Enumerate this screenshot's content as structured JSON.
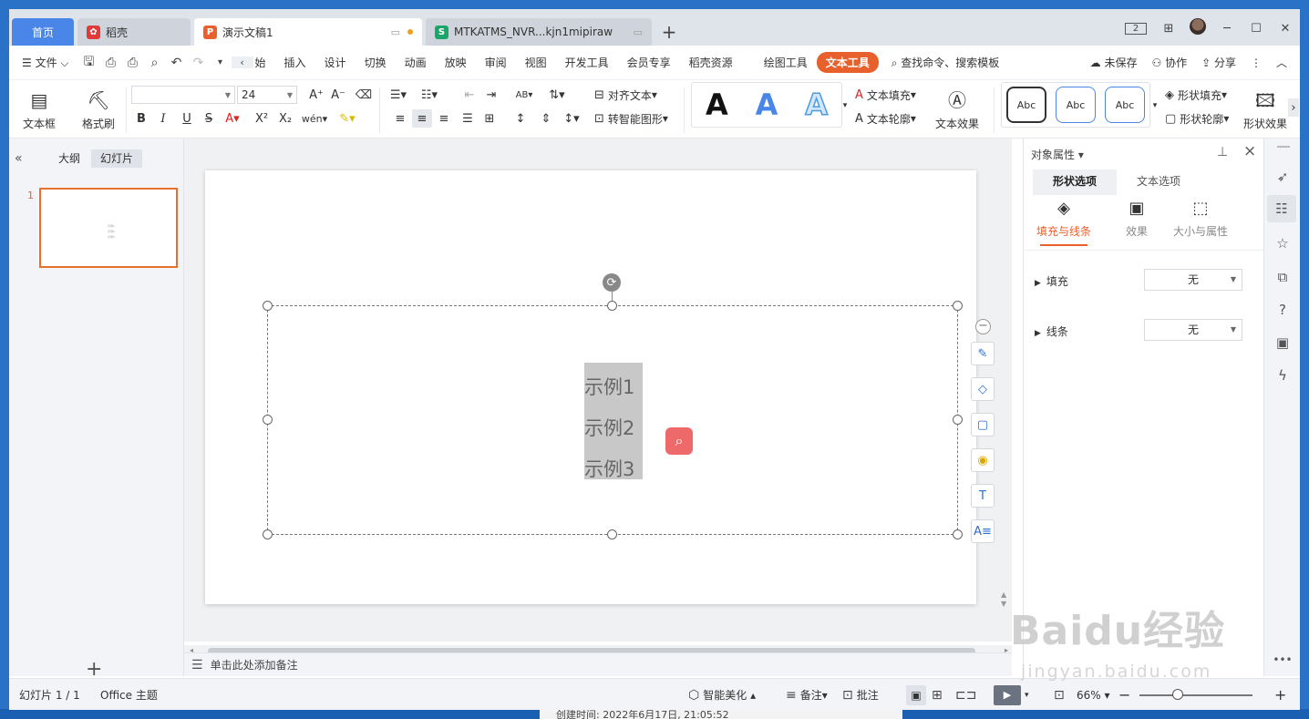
{
  "desktop": {
    "underlying_window_text": "创建时间:        2022年6月17日, 21:05:52"
  },
  "tabs": {
    "home": "首页",
    "docer": "稻壳",
    "presentation": "演示文稿1",
    "sheet": "MTKATMS_NVR...kjn1mipiraw",
    "add": "+"
  },
  "window_controls": {
    "layout_badge": "2",
    "apps": "⊞",
    "minimize": "─",
    "maximize": "☐",
    "close": "✕"
  },
  "menu": {
    "file": "文件",
    "items": [
      "始",
      "插入",
      "设计",
      "切换",
      "动画",
      "放映",
      "审阅",
      "视图",
      "开发工具",
      "会员专享",
      "稻壳资源"
    ],
    "drawing_tools": "绘图工具",
    "text_tools": "文本工具",
    "search_placeholder": "查找命令、搜索模板",
    "unsaved": "未保存",
    "collaborate": "协作",
    "share": "分享"
  },
  "ribbon": {
    "textbox": "文本框",
    "format_painter": "格式刷",
    "font_name": "",
    "font_size": "24",
    "align_text": "对齐文本",
    "smart_shape": "转智能图形",
    "wordart_samples": [
      "A",
      "A",
      "A"
    ],
    "text_fill": "文本填充",
    "text_outline": "文本轮廓",
    "text_effect": "文本效果",
    "shape_styles": [
      "Abc",
      "Abc",
      "Abc"
    ],
    "shape_fill": "形状填充",
    "shape_outline": "形状轮廓",
    "shape_effect": "形状效果"
  },
  "left_pane": {
    "outline_tab": "大纲",
    "slides_tab": "幻灯片",
    "slide_number": "1",
    "thumb_lines": [
      "示例1",
      "示例2",
      "示例3"
    ]
  },
  "slide": {
    "text_lines": [
      "示例1",
      "示例2",
      "示例3"
    ]
  },
  "notes": {
    "placeholder": "单击此处添加备注"
  },
  "properties": {
    "title": "对象属性",
    "tab_shape": "形状选项",
    "tab_text": "文本选项",
    "sub_fill_line": "填充与线条",
    "sub_effect": "效果",
    "sub_size": "大小与属性",
    "fill_label": "填充",
    "fill_value": "无",
    "line_label": "线条",
    "line_value": "无"
  },
  "status": {
    "slide_counter": "幻灯片 1 / 1",
    "theme": "Office 主题",
    "smart_beautify": "智能美化",
    "notes": "备注",
    "comments": "批注",
    "zoom": "66%"
  },
  "watermark": {
    "brand": "Baidu经验",
    "url": "jingyan.baidu.com"
  },
  "colors": {
    "accent": "#e8602c",
    "home_tab": "#4a86e8",
    "taskbar": "#2a72c8"
  }
}
